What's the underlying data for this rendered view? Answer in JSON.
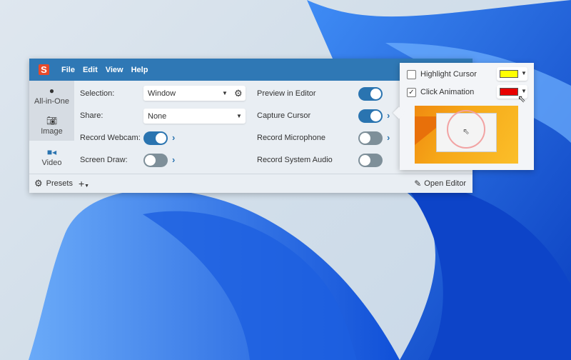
{
  "menu": {
    "logo": "S",
    "items": [
      "File",
      "Edit",
      "View",
      "Help"
    ]
  },
  "sidebar": {
    "tabs": [
      {
        "label": "All-in-One",
        "icon": "record-icon"
      },
      {
        "label": "Image",
        "icon": "camera-icon"
      },
      {
        "label": "Video",
        "icon": "video-camera-icon",
        "selected": true
      }
    ]
  },
  "settings": {
    "selection": {
      "label": "Selection:",
      "value": "Window"
    },
    "share": {
      "label": "Share:",
      "value": "None"
    },
    "record_webcam": {
      "label": "Record Webcam:",
      "on": true
    },
    "screen_draw": {
      "label": "Screen Draw:",
      "on": false
    },
    "preview_in_editor": {
      "label": "Preview in Editor",
      "on": true
    },
    "capture_cursor": {
      "label": "Capture Cursor",
      "on": true
    },
    "record_microphone": {
      "label": "Record Microphone",
      "on": false
    },
    "record_system_audio": {
      "label": "Record System Audio",
      "on": false
    }
  },
  "bottom": {
    "presets": "Presets",
    "add": "+",
    "open_editor": "Open Editor"
  },
  "cursor_popup": {
    "highlight_cursor": {
      "label": "Highlight Cursor",
      "checked": false,
      "color": "#ffff00"
    },
    "click_animation": {
      "label": "Click Animation",
      "checked": true,
      "color": "#e80000"
    }
  },
  "colors": {
    "titlebar": "#2f78b5",
    "accent": "#2a74b0"
  }
}
